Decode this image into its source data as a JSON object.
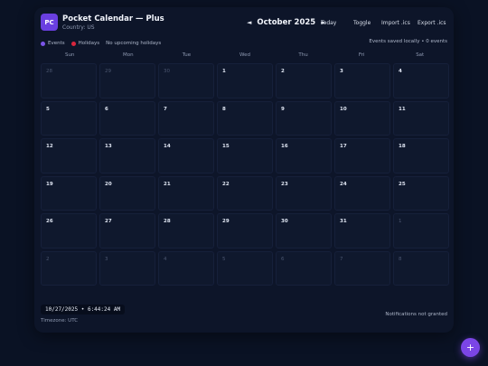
{
  "app": {
    "logo_text": "PC",
    "title": "Pocket Calendar — Plus",
    "country": "Country: US"
  },
  "nav": {
    "prev_symbol": "◄",
    "month_label": "October 2025",
    "next_symbol": "►"
  },
  "toolbar": {
    "today_label": "Today",
    "toggle_label": "Toggle",
    "import_label": "Import .ics",
    "export_label": "Export .ics"
  },
  "legend": {
    "events_label": "Events",
    "holidays_label": "Holidays",
    "upcoming_text": "No upcoming holidays",
    "events_color": "#7b55e8",
    "holidays_color": "#d7263d"
  },
  "status": {
    "saved_text": "Events saved locally • 0 events"
  },
  "weekdays": [
    "Sun",
    "Mon",
    "Tue",
    "Wed",
    "Thu",
    "Fri",
    "Sat"
  ],
  "days": [
    {
      "n": "28",
      "other": true
    },
    {
      "n": "29",
      "other": true
    },
    {
      "n": "30",
      "other": true
    },
    {
      "n": "1"
    },
    {
      "n": "2"
    },
    {
      "n": "3"
    },
    {
      "n": "4"
    },
    {
      "n": "5"
    },
    {
      "n": "6"
    },
    {
      "n": "7"
    },
    {
      "n": "8"
    },
    {
      "n": "9"
    },
    {
      "n": "10"
    },
    {
      "n": "11"
    },
    {
      "n": "12"
    },
    {
      "n": "13"
    },
    {
      "n": "14"
    },
    {
      "n": "15"
    },
    {
      "n": "16"
    },
    {
      "n": "17"
    },
    {
      "n": "18"
    },
    {
      "n": "19"
    },
    {
      "n": "20"
    },
    {
      "n": "21"
    },
    {
      "n": "22"
    },
    {
      "n": "23"
    },
    {
      "n": "24"
    },
    {
      "n": "25"
    },
    {
      "n": "26"
    },
    {
      "n": "27"
    },
    {
      "n": "28"
    },
    {
      "n": "29"
    },
    {
      "n": "30"
    },
    {
      "n": "31"
    },
    {
      "n": "1",
      "other": true
    },
    {
      "n": "2",
      "other": true
    },
    {
      "n": "3",
      "other": true
    },
    {
      "n": "4",
      "other": true
    },
    {
      "n": "5",
      "other": true
    },
    {
      "n": "6",
      "other": true
    },
    {
      "n": "7",
      "other": true
    },
    {
      "n": "8",
      "other": true
    }
  ],
  "footer": {
    "clock_text": "10/27/2025 • 6:44:24 AM",
    "timezone": "Timezone: UTC",
    "notifications": "Notifications not granted"
  },
  "fab": {
    "symbol": "+",
    "accent": "#7b45e6"
  }
}
